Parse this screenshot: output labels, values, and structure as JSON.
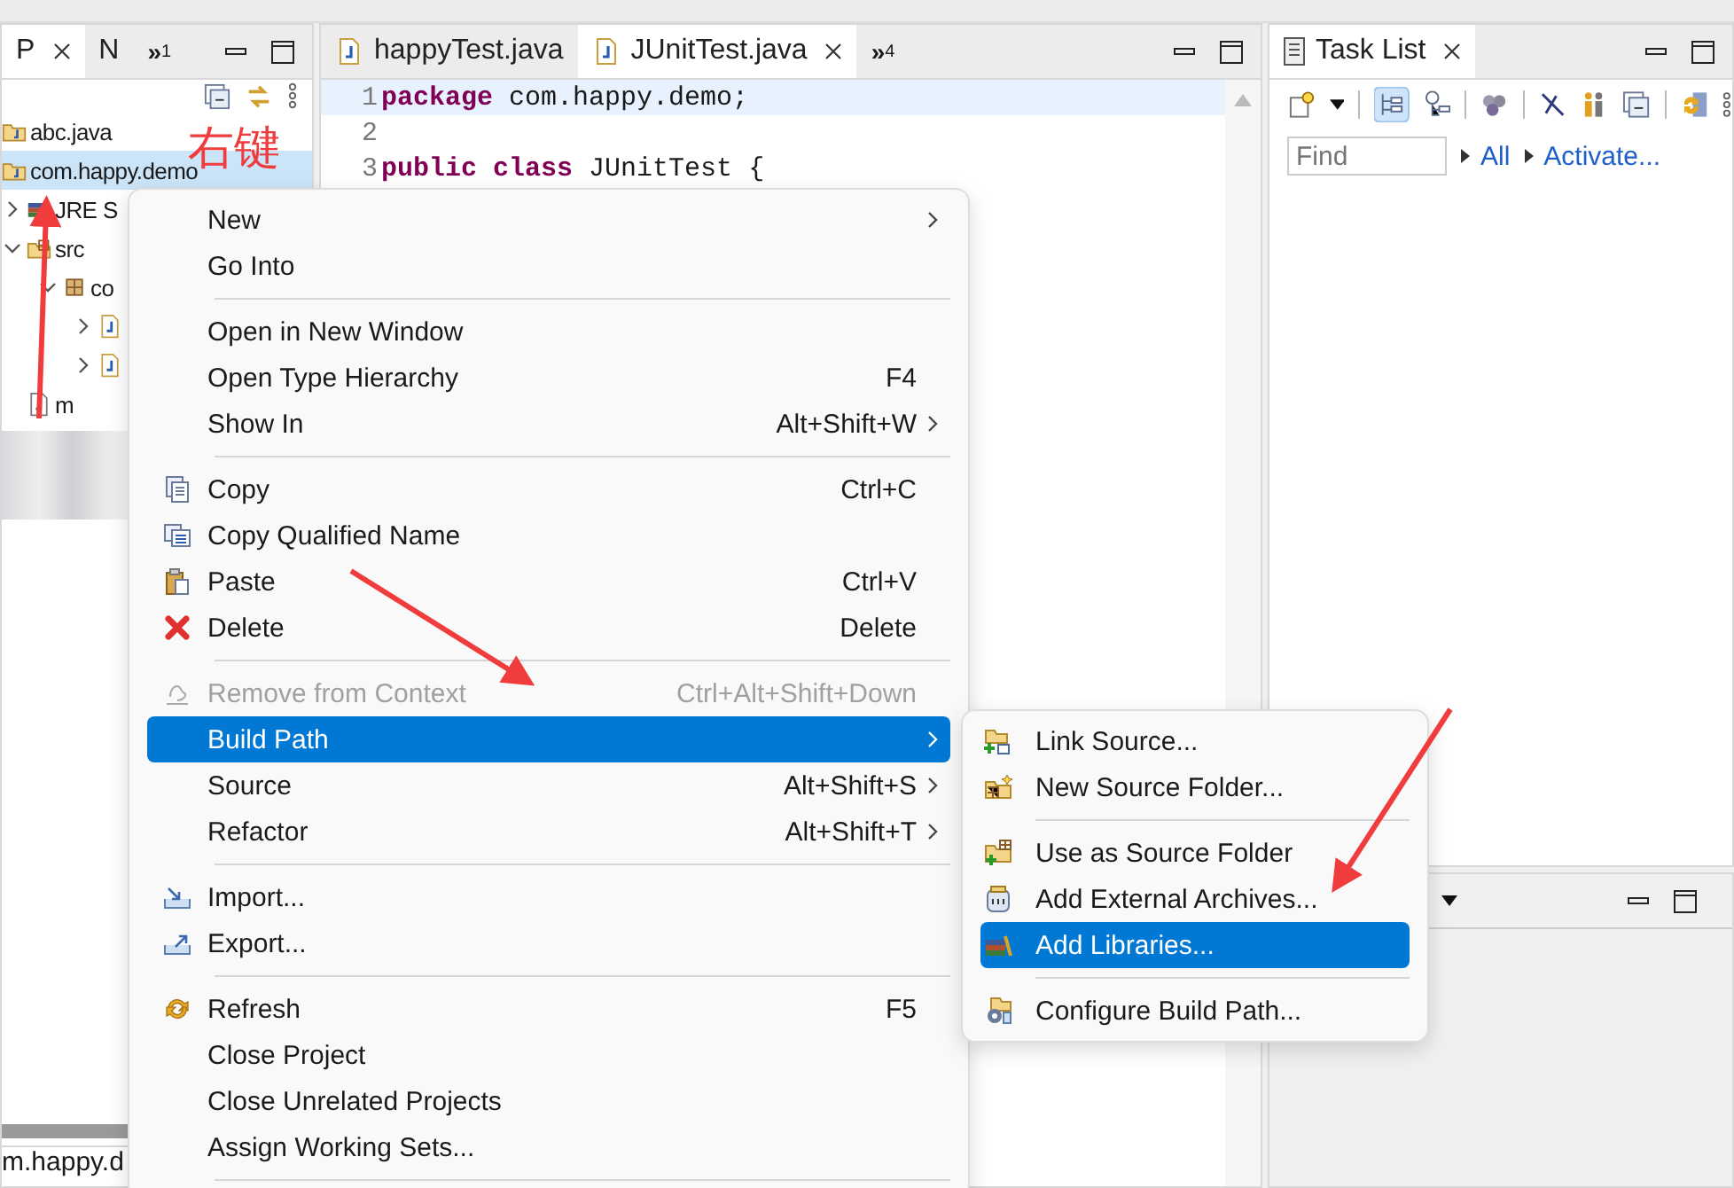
{
  "explorer": {
    "tabs": [
      {
        "label": "P",
        "selected": true,
        "closable": true
      },
      {
        "label": "N",
        "selected": false,
        "closable": false
      }
    ],
    "overflow": {
      "glyph": "»",
      "count": "1"
    },
    "tree": [
      {
        "label": "abc.java",
        "kind": "project",
        "selected": false
      },
      {
        "label": "com.happy.demo",
        "kind": "project",
        "selected": true,
        "children": [
          {
            "label": "JRE S",
            "kind": "library",
            "selected": false,
            "expanded": false
          },
          {
            "label": "src",
            "kind": "source",
            "selected": false,
            "expanded": true,
            "children": [
              {
                "label": "co",
                "kind": "package",
                "selected": false,
                "expanded": true,
                "children": [
                  {
                    "kind": "java",
                    "selected": false,
                    "expanded": false
                  },
                  {
                    "kind": "java",
                    "selected": false,
                    "expanded": false
                  }
                ]
              }
            ]
          },
          {
            "label": "m",
            "kind": "file",
            "selected": false
          }
        ]
      }
    ],
    "footer_text": "m.happy.d"
  },
  "annotation": {
    "text": "右键"
  },
  "editor": {
    "tabs": [
      {
        "label": "happyTest.java",
        "selected": false,
        "closable": false
      },
      {
        "label": "JUnitTest.java",
        "selected": true,
        "closable": true
      }
    ],
    "overflow": {
      "glyph": "»",
      "count": "4"
    },
    "lines": [
      {
        "number": "1",
        "code": "**package** com.happy.demo;",
        "current": true
      },
      {
        "number": "2",
        "current": false
      },
      {
        "number": "3",
        "code": "**public** **class** JUnitTest {",
        "current": false
      }
    ]
  },
  "task_list": {
    "tab": {
      "label": "Task List",
      "closable": true
    },
    "find": {
      "placeholder": "Find"
    },
    "links": [
      "All",
      "Activate..."
    ]
  },
  "context_menu": {
    "items": [
      {
        "kind": "plain",
        "label": "New",
        "submenu": true,
        "disabled": false,
        "selected": false
      },
      {
        "kind": "plain",
        "label": "Go Into",
        "submenu": false,
        "disabled": false,
        "selected": false
      },
      {
        "kind": "separator"
      },
      {
        "kind": "plain",
        "label": "Open in New Window",
        "submenu": false,
        "disabled": false,
        "selected": false
      },
      {
        "kind": "plain",
        "label": "Open Type Hierarchy",
        "shortcut": "F4",
        "submenu": false,
        "disabled": false,
        "selected": false
      },
      {
        "kind": "plain",
        "label": "Show In",
        "shortcut": "Alt+Shift+W",
        "submenu": true,
        "disabled": false,
        "selected": false
      },
      {
        "kind": "separator"
      },
      {
        "kind": "copy",
        "label": "Copy",
        "shortcut": "Ctrl+C",
        "submenu": false,
        "disabled": false,
        "selected": false
      },
      {
        "kind": "copy_name",
        "label": "Copy Qualified Name",
        "submenu": false,
        "disabled": false,
        "selected": false
      },
      {
        "kind": "paste",
        "label": "Paste",
        "shortcut": "Ctrl+V",
        "submenu": false,
        "disabled": false,
        "selected": false
      },
      {
        "kind": "delete",
        "label": "Delete",
        "shortcut": "Delete",
        "submenu": false,
        "disabled": false,
        "selected": false
      },
      {
        "kind": "separator"
      },
      {
        "kind": "remove",
        "label": "Remove from Context",
        "shortcut": "Ctrl+Alt+Shift+Down",
        "submenu": false,
        "disabled": true,
        "selected": false
      },
      {
        "kind": "plain",
        "label": "Build Path",
        "submenu": true,
        "disabled": false,
        "selected": true
      },
      {
        "kind": "plain",
        "label": "Source",
        "shortcut": "Alt+Shift+S",
        "submenu": true,
        "disabled": false,
        "selected": false
      },
      {
        "kind": "plain",
        "label": "Refactor",
        "shortcut": "Alt+Shift+T",
        "submenu": true,
        "disabled": false,
        "selected": false
      },
      {
        "kind": "separator"
      },
      {
        "kind": "import",
        "label": "Import...",
        "submenu": false,
        "disabled": false,
        "selected": false
      },
      {
        "kind": "export",
        "label": "Export...",
        "submenu": false,
        "disabled": false,
        "selected": false
      },
      {
        "kind": "separator"
      },
      {
        "kind": "refresh",
        "label": "Refresh",
        "shortcut": "F5",
        "submenu": false,
        "disabled": false,
        "selected": false
      },
      {
        "kind": "plain",
        "label": "Close Project",
        "submenu": false,
        "disabled": false,
        "selected": false
      },
      {
        "kind": "plain",
        "label": "Close Unrelated Projects",
        "submenu": false,
        "disabled": false,
        "selected": false
      },
      {
        "kind": "plain",
        "label": "Assign Working Sets...",
        "submenu": false,
        "disabled": false,
        "selected": false
      },
      {
        "kind": "separator"
      }
    ]
  },
  "submenu": {
    "items": [
      {
        "kind": "link",
        "label": "Link Source...",
        "selected": false
      },
      {
        "kind": "new_folder",
        "label": "New Source Folder...",
        "selected": false
      },
      {
        "kind": "separator"
      },
      {
        "kind": "use_folder",
        "label": "Use as Source Folder",
        "selected": false
      },
      {
        "kind": "archive",
        "label": "Add External Archives...",
        "selected": false
      },
      {
        "kind": "libraries",
        "label": "Add Libraries...",
        "selected": true
      },
      {
        "kind": "separator"
      },
      {
        "kind": "configure",
        "label": "Configure Build Path...",
        "selected": false
      }
    ]
  }
}
